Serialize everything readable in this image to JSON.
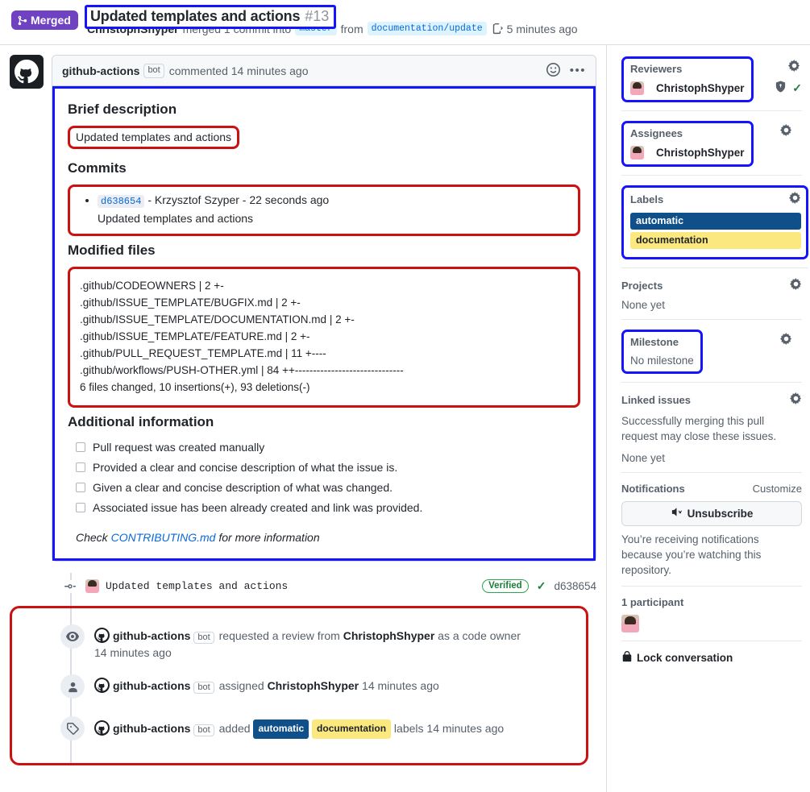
{
  "header": {
    "state_badge": "Merged",
    "state_icon": "merge-icon",
    "title": "Updated templates and actions",
    "number": "#13",
    "actor": "ChristophShyper",
    "merged_text": "merged 1 commit into",
    "base_branch": "master",
    "from_text": "from",
    "head_branch": "documentation/update",
    "copy_icon": "copy-branch-icon",
    "time": "5 minutes ago"
  },
  "comment": {
    "avatar": "github-actions-avatar",
    "author": "github-actions",
    "bot_tag": "bot",
    "action": "commented 14 minutes ago",
    "reaction_icon": "smiley-icon",
    "menu_icon": "kebab-menu-icon",
    "sections": {
      "brief_heading": "Brief description",
      "brief_value": "Updated templates and actions",
      "commits_heading": "Commits",
      "commits": [
        {
          "sha": "d638654",
          "meta": "- Krzysztof Szyper - 22 seconds ago",
          "message": "Updated templates and actions"
        }
      ],
      "files_heading": "Modified files",
      "files_text": ".github/CODEOWNERS | 2 +-\n.github/ISSUE_TEMPLATE/BUGFIX.md | 2 +-\n.github/ISSUE_TEMPLATE/DOCUMENTATION.md | 2 +-\n.github/ISSUE_TEMPLATE/FEATURE.md | 2 +-\n.github/PULL_REQUEST_TEMPLATE.md | 11 +----\n.github/workflows/PUSH-OTHER.yml | 84 ++------------------------------\n6 files changed, 10 insertions(+), 93 deletions(-)",
      "additional_heading": "Additional information",
      "checklist": [
        "Pull request was created manually",
        "Provided a clear and concise description of what the issue is.",
        "Given a clear and concise description of what was changed.",
        "Associated issue has been already created and link was provided."
      ],
      "footnote_pre": "Check",
      "footnote_link": "CONTRIBUTING.md",
      "footnote_post": "for more information"
    }
  },
  "timeline": {
    "commit": {
      "icon": "commit-dot-icon",
      "avatar": "user-avatar",
      "message": "Updated templates and actions",
      "verified": "Verified",
      "check_icon": "check-icon",
      "sha": "d638654"
    },
    "events": [
      {
        "icon": "eye-icon",
        "author": "github-actions",
        "bot_tag": "bot",
        "text_before": "requested a review from",
        "subject": "ChristophShyper",
        "text_after": "as a code owner",
        "time": "14 minutes ago",
        "time_newline": true
      },
      {
        "icon": "person-icon",
        "author": "github-actions",
        "bot_tag": "bot",
        "text_before": "assigned",
        "subject": "ChristophShyper",
        "text_after": "",
        "time": "14 minutes ago",
        "time_newline": false
      },
      {
        "icon": "tag-icon",
        "author": "github-actions",
        "bot_tag": "bot",
        "text_before": "added",
        "labels": [
          "automatic",
          "documentation"
        ],
        "text_after": "labels",
        "time": "14 minutes ago",
        "time_newline": false
      }
    ]
  },
  "sidebar": {
    "reviewers": {
      "title": "Reviewers",
      "gear_icon": "gear-icon",
      "person": "ChristophShyper",
      "shield_icon": "shield-icon",
      "approved_icon": "check-icon"
    },
    "assignees": {
      "title": "Assignees",
      "gear_icon": "gear-icon",
      "person": "ChristophShyper"
    },
    "labels": {
      "title": "Labels",
      "gear_icon": "gear-icon",
      "items": [
        {
          "name": "automatic",
          "bg": "#10508a",
          "fg": "#ffffff"
        },
        {
          "name": "documentation",
          "bg": "#fbe97f",
          "fg": "#1f2328"
        }
      ]
    },
    "projects": {
      "title": "Projects",
      "gear_icon": "gear-icon",
      "value": "None yet"
    },
    "milestone": {
      "title": "Milestone",
      "gear_icon": "gear-icon",
      "value": "No milestone"
    },
    "linked_issues": {
      "title": "Linked issues",
      "gear_icon": "gear-icon",
      "note": "Successfully merging this pull request may close these issues.",
      "value": "None yet"
    },
    "notifications": {
      "title": "Notifications",
      "customize": "Customize",
      "button_label": "Unsubscribe",
      "button_icon": "mute-icon",
      "note": "You’re receiving notifications because you’re watching this repository."
    },
    "participants": {
      "count_label": "1 participant",
      "avatar": "user-avatar"
    },
    "lock": {
      "icon": "lock-icon",
      "label": "Lock conversation"
    }
  },
  "colors": {
    "merged_purple": "#6f42c1",
    "annotation_blue": "#1414ff",
    "annotation_red": "#cc1111",
    "link_blue": "#0969da",
    "green": "#1a7f37"
  }
}
